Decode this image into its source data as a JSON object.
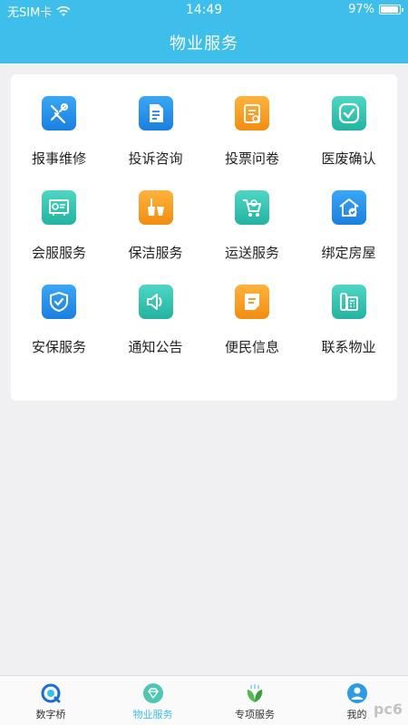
{
  "status_bar": {
    "carrier": "无SIM卡",
    "time": "14:49",
    "battery": "97%",
    "battery_level": 0.97
  },
  "header": {
    "title": "物业服务"
  },
  "services": [
    {
      "label": "报事维修",
      "icon": "tools-icon",
      "color": "blue"
    },
    {
      "label": "投诉咨询",
      "icon": "document-edit-icon",
      "color": "blue"
    },
    {
      "label": "投票问卷",
      "icon": "checklist-icon",
      "color": "orange"
    },
    {
      "label": "医废确认",
      "icon": "check-circle-icon",
      "color": "teal"
    },
    {
      "label": "会服服务",
      "icon": "monitor-icon",
      "color": "teal"
    },
    {
      "label": "保洁服务",
      "icon": "broom-bucket-icon",
      "color": "orange"
    },
    {
      "label": "运送服务",
      "icon": "cart-icon",
      "color": "teal"
    },
    {
      "label": "绑定房屋",
      "icon": "house-check-icon",
      "color": "blue"
    },
    {
      "label": "安保服务",
      "icon": "shield-check-icon",
      "color": "blue"
    },
    {
      "label": "通知公告",
      "icon": "speaker-icon",
      "color": "teal"
    },
    {
      "label": "便民信息",
      "icon": "note-icon",
      "color": "orange"
    },
    {
      "label": "联系物业",
      "icon": "phone-icon",
      "color": "teal"
    }
  ],
  "tabbar": {
    "tabs": [
      {
        "label": "数字桥",
        "icon": "bridge-logo-icon",
        "active": false
      },
      {
        "label": "物业服务",
        "icon": "diamond-icon",
        "active": true
      },
      {
        "label": "专项服务",
        "icon": "leaf-icon",
        "active": false
      },
      {
        "label": "我的",
        "icon": "user-icon",
        "active": false
      }
    ]
  },
  "colors": {
    "header": "#3ebeeb",
    "active_tab": "#3ebeeb",
    "blue": "#1a7fe0",
    "orange": "#f28d12",
    "teal": "#23b3a0"
  },
  "watermark": "pc6"
}
